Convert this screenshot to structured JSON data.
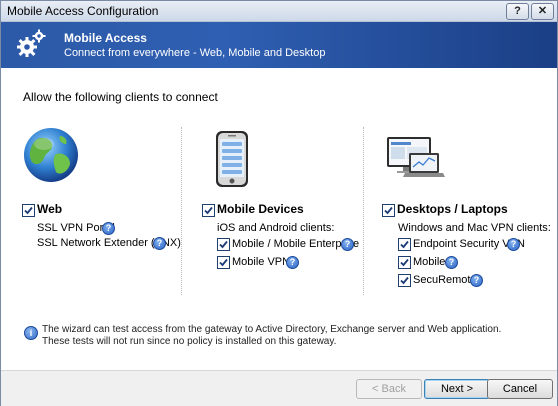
{
  "window": {
    "title": "Mobile Access Configuration",
    "help_button": "?",
    "close_button": "✕"
  },
  "banner": {
    "title": "Mobile Access",
    "subtitle": "Connect from everywhere - Web, Mobile and Desktop"
  },
  "heading": "Allow the following clients to connect",
  "web": {
    "label": "Web",
    "checked": true,
    "items": [
      {
        "label": "SSL VPN Portal"
      },
      {
        "label": "SSL Network Extender (SNX)"
      }
    ]
  },
  "mobile": {
    "label": "Mobile Devices",
    "checked": true,
    "subtitle": "iOS and Android clients:",
    "items": [
      {
        "label": "Mobile / Mobile Enterprise",
        "checked": true
      },
      {
        "label": "Mobile VPN",
        "checked": true
      }
    ]
  },
  "desktop": {
    "label": "Desktops / Laptops",
    "checked": true,
    "subtitle": "Windows and Mac VPN clients:",
    "items": [
      {
        "label": "Endpoint Security VPN",
        "checked": true
      },
      {
        "label": "Mobile",
        "checked": true
      },
      {
        "label": "SecuRemote",
        "checked": true
      }
    ]
  },
  "info": {
    "line1": "The wizard can test access from the gateway to Active Directory, Exchange server and Web application.",
    "line2": "These tests will not run since no policy is installed on this gateway."
  },
  "buttons": {
    "back": "< Back",
    "next": "Next >",
    "cancel": "Cancel"
  },
  "colors": {
    "banner": "#2c5aa8",
    "help_icon": "#2c63c4"
  }
}
